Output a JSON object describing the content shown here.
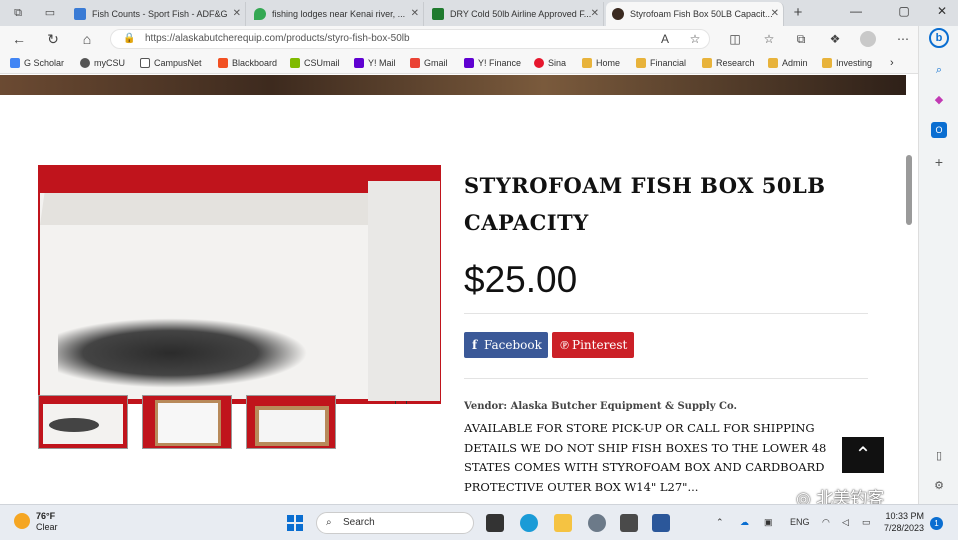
{
  "browser": {
    "tabs": [
      {
        "title": "Fish Counts - Sport Fish - ADF&G",
        "icon": "fish-page-favicon"
      },
      {
        "title": "fishing lodges near Kenai river, ...",
        "icon": "maps-favicon"
      },
      {
        "title": "DRY Cold 50lb Airline Approved F...",
        "icon": "sw-favicon"
      },
      {
        "title": "Styrofoam Fish Box 50LB Capacit...",
        "icon": "store-favicon"
      }
    ],
    "new_tab": "+",
    "url": "https://alaskabutcherequip.com/products/styro-fish-box-50lb",
    "favorites": [
      {
        "label": "G Scholar"
      },
      {
        "label": "myCSU"
      },
      {
        "label": "CampusNet"
      },
      {
        "label": "Blackboard"
      },
      {
        "label": "CSUmail"
      },
      {
        "label": "Y! Mail"
      },
      {
        "label": "Gmail"
      },
      {
        "label": "Y! Finance"
      },
      {
        "label": "Sina"
      },
      {
        "label": "Home"
      },
      {
        "label": "Financial"
      },
      {
        "label": "Research"
      },
      {
        "label": "Admin"
      },
      {
        "label": "Investing"
      }
    ]
  },
  "product": {
    "title": "STYROFOAM FISH BOX 50LB CAPACITY",
    "price": "$25.00",
    "share": {
      "facebook": "Facebook",
      "pinterest": "Pinterest"
    },
    "vendor": "Vendor: Alaska Butcher Equipment & Supply Co.",
    "description": "AVAILABLE FOR STORE PICK-UP OR CALL FOR SHIPPING DETAILS WE DO NOT SHIP FISH BOXES TO THE LOWER 48 STATES COMES WITH STYROFOAM BOX AND CARDBOARD PROTECTIVE OUTER BOX W14\" L27\"..."
  },
  "taskbar": {
    "weather_temp": "76°F",
    "weather_desc": "Clear",
    "search": "Search",
    "lang": "ENG",
    "time": "10:33 PM",
    "date": "7/28/2023",
    "notifications": "1"
  },
  "watermark": "北美钓客",
  "colors": {
    "facebook": "#3b5998",
    "pinterest": "#cb2027",
    "image_bg": "#c0141c"
  }
}
